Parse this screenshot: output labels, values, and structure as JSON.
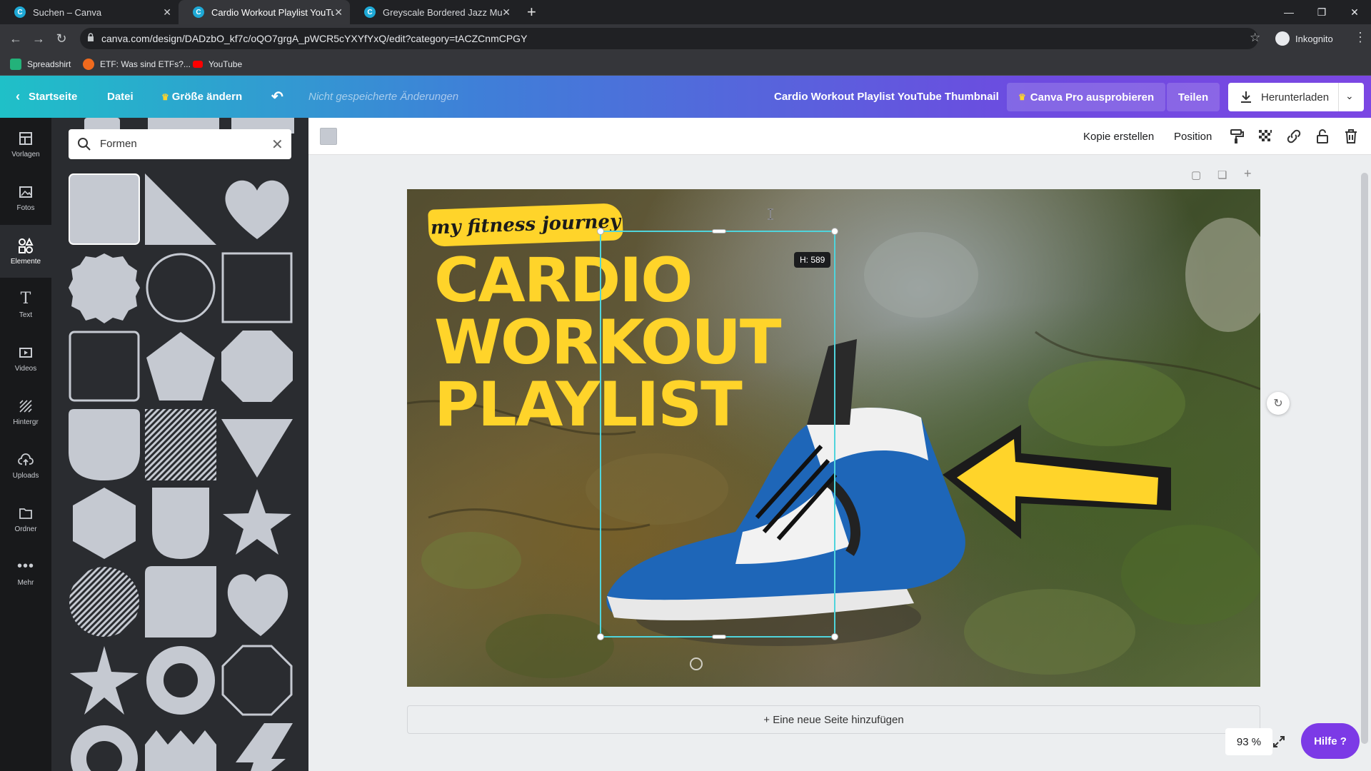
{
  "browser": {
    "tabs": [
      {
        "label": "Suchen – Canva",
        "close": "✕"
      },
      {
        "label": "Cardio Workout Playlist YouTube",
        "close": "✕"
      },
      {
        "label": "Greyscale Bordered Jazz Music Y",
        "close": "✕"
      }
    ],
    "new_tab": "+",
    "favicon_letter": "C",
    "url": "canva.com/design/DADzbO_kf7c/oQO7grgA_pWCR5cYXYfYxQ/edit?category=tACZCnmCPGY",
    "profile": "Inkognito",
    "bookmarks": [
      "Spreadshirt",
      "ETF: Was sind ETFs?...",
      "YouTube"
    ]
  },
  "canva_bar": {
    "home": "Startseite",
    "file": "Datei",
    "resize": "Größe ändern",
    "unsaved": "Nicht gespeicherte Änderungen",
    "title": "Cardio Workout Playlist YouTube Thumbnail",
    "pro": "Canva Pro ausprobieren",
    "share": "Teilen",
    "download": "Herunterladen"
  },
  "rail": [
    {
      "label": "Vorlagen",
      "icon": "templates-icon"
    },
    {
      "label": "Fotos",
      "icon": "photos-icon"
    },
    {
      "label": "Elemente",
      "icon": "elements-icon"
    },
    {
      "label": "Text",
      "icon": "text-icon"
    },
    {
      "label": "Videos",
      "icon": "videos-icon"
    },
    {
      "label": "Hintergr",
      "icon": "background-icon"
    },
    {
      "label": "Uploads",
      "icon": "uploads-icon"
    },
    {
      "label": "Ordner",
      "icon": "folder-icon"
    },
    {
      "label": "Mehr",
      "icon": "more-icon"
    }
  ],
  "panel": {
    "search_value": "Formen"
  },
  "toolbar": {
    "copy": "Kopie erstellen",
    "position": "Position"
  },
  "design": {
    "tag": "my fitness journey",
    "headline": [
      "CARDIO",
      "WORKOUT",
      "PLAYLIST"
    ],
    "height_badge": "H: 589"
  },
  "footer": {
    "add_page": "+ Eine neue Seite hinzufügen",
    "zoom": "93 %",
    "help": "Hilfe ?"
  },
  "colors": {
    "accent_yellow": "#ffd42a",
    "selection": "#4fd4dc",
    "help_purple": "#7c3ae6"
  }
}
